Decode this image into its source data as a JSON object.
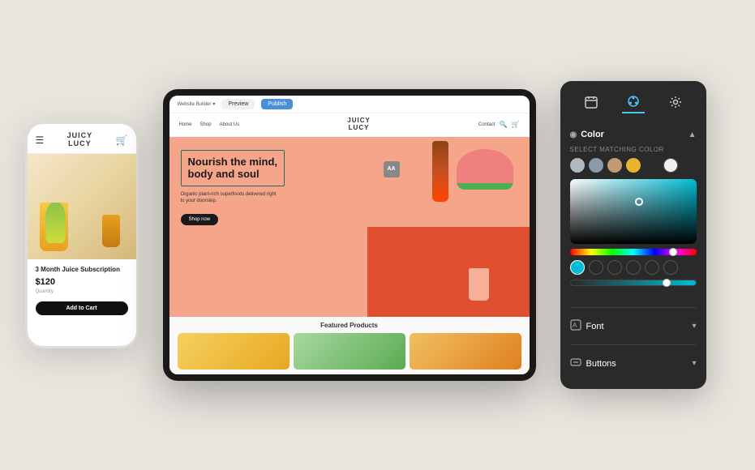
{
  "scene": {
    "background_color": "#e8e4de"
  },
  "phone": {
    "logo_line1": "JUICY",
    "logo_line2": "LUCY",
    "product_title": "3 Month Juice Subscription",
    "price": "$120",
    "quantity_label": "Quantity",
    "add_to_cart": "Add to Cart"
  },
  "tablet": {
    "toolbar": {
      "builder_label": "Website Builder",
      "preview_btn": "Preview",
      "publish_btn": "Publish"
    },
    "nav": {
      "links": [
        "Home",
        "Shop",
        "About Us"
      ],
      "logo_line1": "JUICY",
      "logo_line2": "LUCY",
      "right_link": "Contact"
    },
    "hero": {
      "title_line1": "Nourish the mind,",
      "title_line2": "body and soul",
      "subtitle": "Organic plant-rich superfoods delivered right to your doorstep.",
      "cta": "Shop now"
    },
    "products_section": {
      "title": "Featured Products"
    }
  },
  "right_panel": {
    "icons": {
      "calendar": "🗓",
      "palette": "🎨",
      "gear": "⚙"
    },
    "color_section": {
      "title": "Color",
      "select_label": "SELECT MATCHING COLOR",
      "swatches": [
        {
          "color": "#b0b8c0",
          "selected": false
        },
        {
          "color": "#8a9aa8",
          "selected": false
        },
        {
          "color": "#c49a72",
          "selected": false
        },
        {
          "color": "#e8b430",
          "selected": false
        },
        {
          "color": "#2a2a2a",
          "selected": false
        },
        {
          "color": "#f0f0f0",
          "selected": false
        }
      ],
      "output_colors": [
        {
          "color": "#00bcd4",
          "active": true
        },
        {
          "color": "empty"
        },
        {
          "color": "empty"
        },
        {
          "color": "empty"
        },
        {
          "color": "empty"
        },
        {
          "color": "empty"
        }
      ]
    },
    "font_section": {
      "title": "Font",
      "icon": "A"
    },
    "buttons_section": {
      "title": "Buttons"
    }
  }
}
